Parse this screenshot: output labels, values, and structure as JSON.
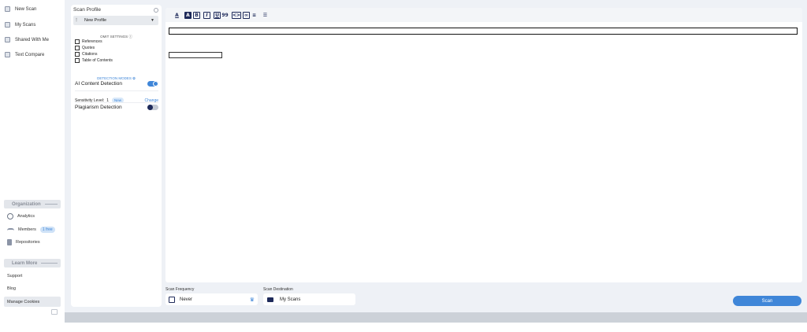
{
  "sidebar": {
    "nav": [
      {
        "label": "New Scan",
        "icon": "document-icon"
      },
      {
        "label": "My Scans",
        "icon": "folder-icon"
      },
      {
        "label": "Shared With Me",
        "icon": "shared-folder-icon"
      },
      {
        "label": "Text Compare",
        "icon": "compare-icon"
      }
    ],
    "organization_heading": "Organization",
    "org_items": {
      "analytics": "Analytics",
      "members": "Members",
      "members_badge": "1 free",
      "repositories": "Repositories"
    },
    "learn_more_heading": "Learn More",
    "links": {
      "support": "Support",
      "blog": "Blog",
      "cookies": "Manage Cookies"
    }
  },
  "profile": {
    "title": "Scan Profile",
    "selected": "New Profile",
    "omit_heading": "OMIT SETTINGS",
    "omit_items": [
      "References",
      "Quotes",
      "Citations",
      "Table of Contents"
    ],
    "detection_heading": "DETECTION MODES",
    "ai_label": "AI Content Detection",
    "ai_enabled": true,
    "sensitivity_label": "Sensitivity Level:",
    "sensitivity_value": "1",
    "sensitivity_badge": "New",
    "change_label": "Change",
    "plagiarism_label": "Plagiarism Detection",
    "plagiarism_enabled": false
  },
  "toolbar": {
    "buttons": [
      {
        "glyph": "A",
        "name": "text-color-button"
      },
      {
        "glyph": "A",
        "name": "highlight-button"
      },
      {
        "glyph": "B",
        "name": "bold-button"
      },
      {
        "glyph": "I",
        "name": "italic-button"
      },
      {
        "glyph": "U",
        "name": "underline-button"
      },
      {
        "glyph": "99",
        "name": "quote-button"
      },
      {
        "glyph": "<>",
        "name": "code-button"
      },
      {
        "glyph": "∞",
        "name": "link-button"
      },
      {
        "glyph": "≡",
        "name": "bullet-list-button"
      },
      {
        "glyph": "☰",
        "name": "numbered-list-button"
      }
    ]
  },
  "bottom": {
    "frequency_label": "Scan Frequency",
    "frequency_value": "Never",
    "destination_label": "Scan Destination",
    "destination_value": "My Scans",
    "scan_button": "Scan"
  },
  "colors": {
    "accent": "#3f86d8",
    "navy": "#1e2a5a",
    "background": "#eef1f6"
  }
}
